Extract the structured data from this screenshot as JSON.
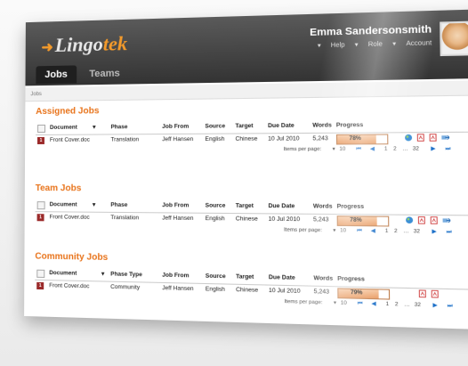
{
  "app": {
    "logo_text_main": "Lingo",
    "logo_text_accent": "tek",
    "logo_arrow": "➜"
  },
  "nav": {
    "tabs": [
      {
        "label": "Jobs",
        "active": true
      },
      {
        "label": "Teams",
        "active": false
      }
    ]
  },
  "user": {
    "name": "Emma Sandersonsmith",
    "menu": [
      "Help",
      "Role",
      "Account"
    ]
  },
  "breadcrumb": "Jobs",
  "sections": {
    "assigned": {
      "title": "Assigned Jobs",
      "headers": {
        "document": "Document",
        "phase": "Phase",
        "job_from": "Job From",
        "source": "Source",
        "target": "Target",
        "due_date": "Due Date",
        "words": "Words",
        "progress": "Progress"
      },
      "row": {
        "doc_num": "1",
        "document": "Front Cover.doc",
        "phase": "Translation",
        "job_from": "Jeff Hansen",
        "source": "English",
        "target": "Chinese",
        "due_date": "10 Jul 2010",
        "words": "5,243",
        "progress_label": "78%",
        "progress_value": 78
      },
      "pager": {
        "label": "Items per page:",
        "per_page": "10",
        "page1": "1",
        "page2": "2",
        "ellipsis": "…",
        "last": "32"
      }
    },
    "team": {
      "title": "Team Jobs",
      "headers": {
        "document": "Document",
        "phase": "Phase",
        "job_from": "Job From",
        "source": "Source",
        "target": "Target",
        "due_date": "Due Date",
        "words": "Words",
        "progress": "Progress"
      },
      "row": {
        "doc_num": "1",
        "document": "Front Cover.doc",
        "phase": "Translation",
        "job_from": "Jeff Hansen",
        "source": "English",
        "target": "Chinese",
        "due_date": "10 Jul 2010",
        "words": "5,243",
        "progress_label": "78%",
        "progress_value": 78
      },
      "pager": {
        "label": "Items per page:",
        "per_page": "10",
        "page1": "1",
        "page2": "2",
        "ellipsis": "…",
        "last": "32"
      }
    },
    "community": {
      "title": "Community Jobs",
      "headers": {
        "document": "Document",
        "phase": "Phase Type",
        "job_from": "Job From",
        "source": "Source",
        "target": "Target",
        "due_date": "Due Date",
        "words": "Words",
        "progress": "Progress"
      },
      "row": {
        "doc_num": "1",
        "document": "Front Cover.doc",
        "phase": "Community",
        "job_from": "Jeff Hansen",
        "source": "English",
        "target": "Chinese",
        "due_date": "10 Jul 2010",
        "words": "5,243",
        "progress_label": "79%",
        "progress_value": 79
      },
      "pager": {
        "label": "Items per page:",
        "per_page": "10",
        "page1": "1",
        "page2": "2",
        "ellipsis": "…",
        "last": "32"
      }
    }
  },
  "colors": {
    "accent": "#e8731a",
    "topbar": "#3a3a3a",
    "pager_blue": "#1b6fc8",
    "doc_icon": "#9b2a2a"
  },
  "icons": [
    "sort-checkbox-icon",
    "doc-icon",
    "globe-icon",
    "pdf-icon",
    "pdf-icon",
    "export-icon",
    "dropdown-arrow-icon",
    "first-page-icon",
    "prev-page-icon",
    "next-page-icon",
    "last-page-icon"
  ]
}
